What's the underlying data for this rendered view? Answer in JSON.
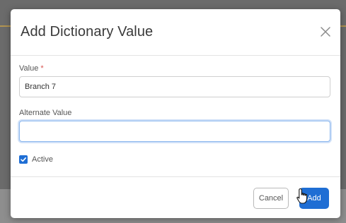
{
  "dialog": {
    "title": "Add Dictionary Value",
    "close_icon": "close-icon"
  },
  "form": {
    "value": {
      "label": "Value",
      "required_marker": "*",
      "input_value": "Branch 7"
    },
    "alternate_value": {
      "label": "Alternate Value",
      "input_value": ""
    },
    "active": {
      "label": "Active",
      "checked": true
    }
  },
  "footer": {
    "cancel_label": "Cancel",
    "add_label": "Add"
  },
  "colors": {
    "primary": "#1f6ed4",
    "required": "#d9534f",
    "focus_ring": "#8cb7ee"
  },
  "pointer": "hand-cursor-icon"
}
